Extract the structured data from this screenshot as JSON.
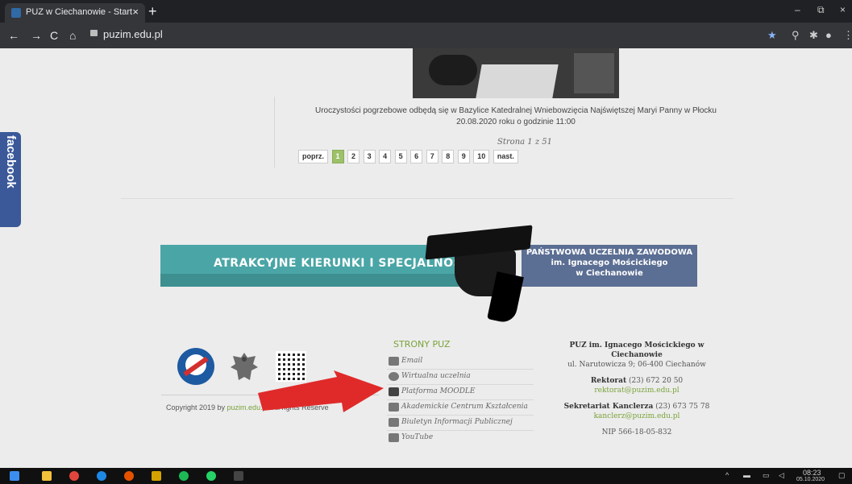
{
  "browser": {
    "tab_title": "PUZ w Ciechanowie - Start",
    "tab_close": "×",
    "new_tab": "+",
    "url": "puzim.edu.pl",
    "win_min": "–",
    "win_max": "⧉",
    "win_close": "×"
  },
  "sidebar": {
    "facebook_label": "facebook"
  },
  "article": {
    "caption": "Uroczystości pogrzebowe odbędą się w Bazylice Katedralnej Wniebowzięcia Najświętszej Maryi Panny w Płocku 20.08.2020 roku o godzinie 11:00"
  },
  "pagination": {
    "page_info": "Strona 1 z 51",
    "prev": "poprz.",
    "next": "nast.",
    "pages": [
      "1",
      "2",
      "3",
      "4",
      "5",
      "6",
      "7",
      "8",
      "9",
      "10"
    ],
    "current": "1"
  },
  "banner": {
    "left_text": "ATRAKCYJNE KIERUNKI I SPECJALNOŚCI",
    "right_line1": "PAŃSTWOWA UCZELNIA ZAWODOWA",
    "right_line2": "im. Ignacego Mościckiego",
    "right_line3": "w Ciechanowie"
  },
  "footer": {
    "copyright_prefix": "Copyright 2019 by ",
    "copyright_link": "puzim.edu.pl.",
    "copyright_suffix": " All rights Reserve",
    "strony_title": "STRONY PUZ",
    "links": [
      {
        "label": "Email",
        "icon": "email-icon"
      },
      {
        "label": "Wirtualna uczelnia",
        "icon": "wordpress-icon"
      },
      {
        "label": "Platforma MOODLE",
        "icon": "moodle-icon"
      },
      {
        "label": "Akademickie Centrum Kształcenia",
        "icon": "acks-icon"
      },
      {
        "label": "Biuletyn Informacji Publicznej",
        "icon": "bip-icon"
      },
      {
        "label": "YouTube",
        "icon": "youtube-icon"
      }
    ],
    "contact": {
      "name": "PUZ im. Ignacego Mościckiego w Ciechanowie",
      "address": "ul. Narutowicza 9; 06-400 Ciechanów",
      "rektorat_label": "Rektorat",
      "rektorat_phone": " (23) 672 20 50",
      "rektorat_email": "rektorat@puzim.edu.pl",
      "kanclerz_label": "Sekretariat Kanclerza",
      "kanclerz_phone": " (23) 673 75 78",
      "kanclerz_email": "kanclerz@puzim.edu.pl",
      "nip": "NIP 566-18-05-832"
    }
  },
  "taskbar": {
    "time": "08:23",
    "date": "05.10.2020"
  },
  "colors": {
    "accent_green": "#7aa33a",
    "facebook_blue": "#3b5998",
    "banner_teal": "#4aa5a6",
    "banner_slate": "#5b6e93",
    "arrow_red": "#e02a2a"
  }
}
